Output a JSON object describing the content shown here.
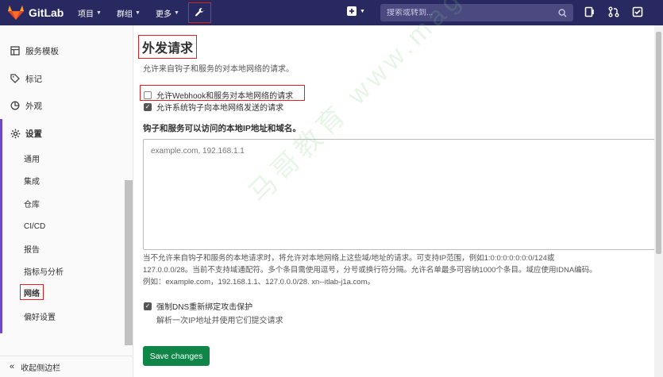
{
  "topbar": {
    "brand": "GitLab",
    "nav": [
      {
        "label": "项目"
      },
      {
        "label": "群组"
      },
      {
        "label": "更多"
      }
    ],
    "search_placeholder": "搜索或转到...",
    "admin_icon": "wrench-icon",
    "new_icon": "plus-square-icon"
  },
  "sidebar": {
    "items": [
      {
        "label": "服务模板",
        "icon": "template-icon"
      },
      {
        "label": "标记",
        "icon": "label-icon"
      },
      {
        "label": "外观",
        "icon": "appearance-icon"
      },
      {
        "label": "设置",
        "icon": "gear-icon"
      }
    ],
    "sub_items": [
      "通用",
      "集成",
      "仓库",
      "CI/CD",
      "报告",
      "指标与分析",
      "网络",
      "偏好设置"
    ],
    "collapse_label": "收起侧边栏"
  },
  "main": {
    "title": "外发请求",
    "description": "允许来自钩子和服务的对本地网络的请求。",
    "checkbox1_label": "允许Webhook和服务对本地网络的请求",
    "checkbox1_checked": false,
    "checkbox2_label": "允许系统钩子向本地网络发送的请求",
    "checkbox2_checked": true,
    "allowlist_label": "钩子和服务可以访问的本地IP地址和域名。",
    "allowlist_placeholder": "example.com, 192.168.1.1",
    "help_line1": "当不允许来自钩子和服务的本地请求时，将允许对本地网络上这些域/地址的请求。可支持IP范围，例如1:0:0:0:0:0:0:0/124或",
    "help_line2": "127.0.0.0/28。当前不支持域通配符。多个条目需使用逗号，分号或换行符分隔。允许名单最多可容纳1000个条目。域应使用IDNA编码。",
    "help_line3": "例如：example.com，192.168.1.1、127.0.0.0/28. xn--itlab-j1a.com。",
    "dns_label": "强制DNS重新绑定攻击保护",
    "dns_checked": true,
    "dns_help": "解析一次IP地址并使用它们提交请求",
    "save_label": "Save changes"
  },
  "watermark": "马哥教育 www.magedu.com",
  "colors": {
    "nav_bg": "#292961",
    "accent": "#6e49cb",
    "save": "#108548",
    "highlight": "#dd2222"
  }
}
